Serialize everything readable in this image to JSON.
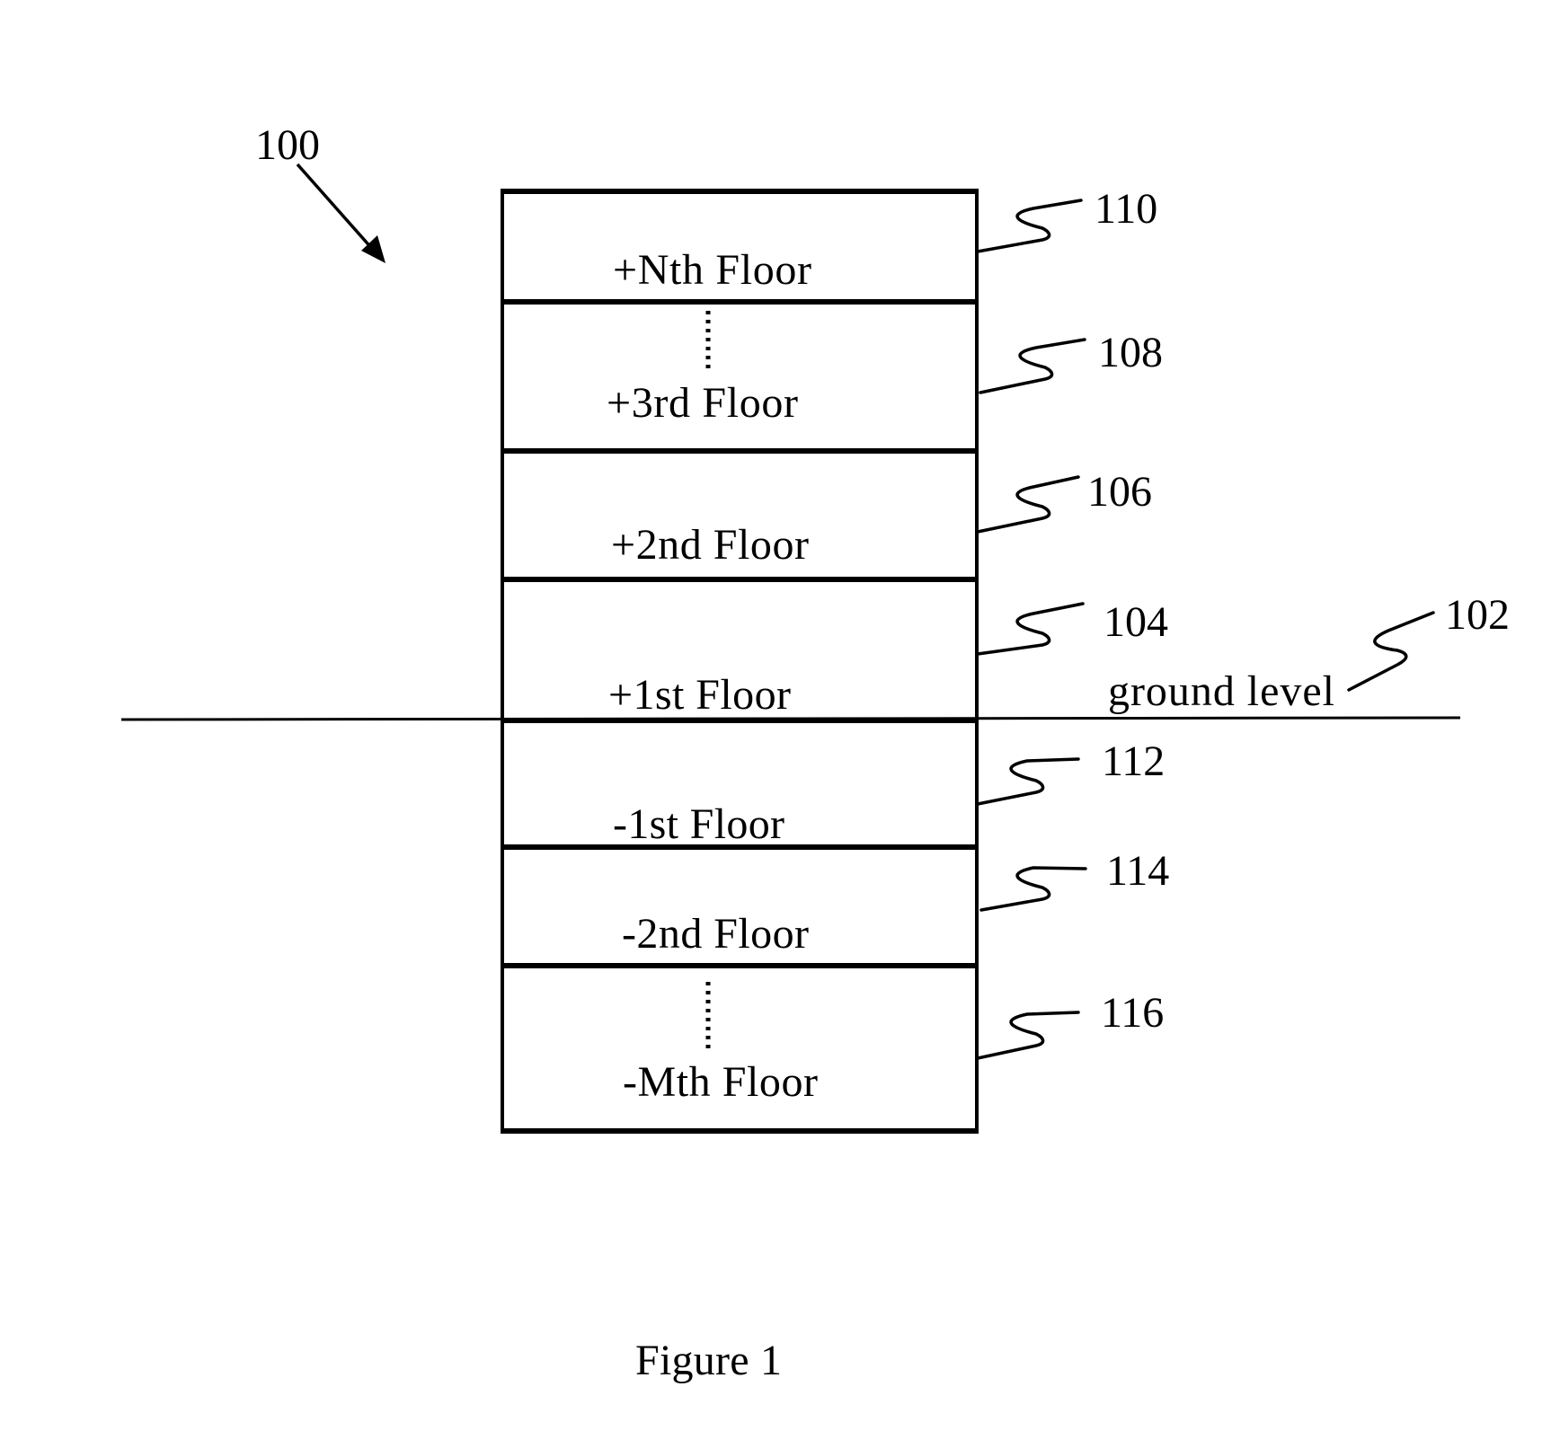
{
  "figure": {
    "caption": "Figure 1",
    "building_ref": "100",
    "ground": {
      "label": "ground level",
      "ref": "102"
    },
    "floors": [
      {
        "label": "+Nth Floor",
        "ref": "110",
        "ellipsis_above": false
      },
      {
        "label": "+3rd Floor",
        "ref": "108",
        "ellipsis_above": true
      },
      {
        "label": "+2nd Floor",
        "ref": "106",
        "ellipsis_above": false
      },
      {
        "label": "+1st Floor",
        "ref": "104",
        "ellipsis_above": false
      },
      {
        "label": "-1st Floor",
        "ref": "112",
        "ellipsis_above": false
      },
      {
        "label": "-2nd Floor",
        "ref": "114",
        "ellipsis_above": false
      },
      {
        "label": "-Mth Floor",
        "ref": "116",
        "ellipsis_above": true
      }
    ]
  }
}
